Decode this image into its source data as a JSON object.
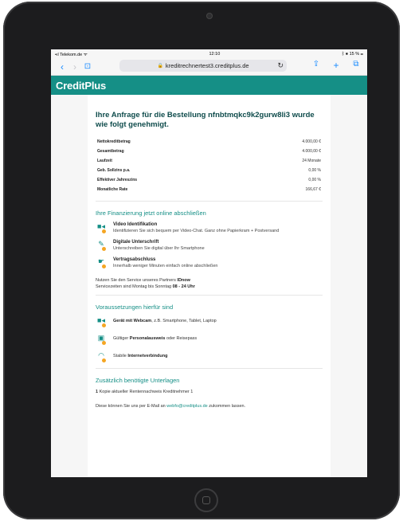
{
  "status": {
    "carrier": "Telekom.de",
    "time": "12:10",
    "battery": "15 %"
  },
  "browser": {
    "url": "kreditrechnertest3.creditplus.de",
    "icons": [
      "back-icon",
      "forward-icon",
      "bookmarks-icon",
      "reload-icon",
      "share-icon",
      "add-tab-icon",
      "tabs-icon"
    ]
  },
  "brand": {
    "logo_text": "CreditPlus",
    "color": "#158f86"
  },
  "main": {
    "headline": "Ihre Anfrage für die Bestellung nfnbtmqkc9k2gurw8li3 wurde wie folgt genehmigt.",
    "summary": [
      {
        "label": "Nettokreditbetrag",
        "value": "4.000,00 €"
      },
      {
        "label": "Gesamtbetrag",
        "value": "4.000,00 €"
      },
      {
        "label": "Laufzeit",
        "value": "24 Monate"
      },
      {
        "label": "Geb. Sollzins p.a.",
        "value": "0,00 %"
      },
      {
        "label": "Effektiver Jahreszins",
        "value": "0,00 %"
      },
      {
        "label": "Monatliche Rate",
        "value": "166,67 €"
      }
    ],
    "finance_title": "Ihre Finanzierung jetzt online abschließen",
    "steps": [
      {
        "icon": "video-camera-icon",
        "title": "Video Identifikation",
        "desc": "Identifizieren Sie sich bequem per Video-Chat. Ganz ohne Papierkram + Postversand"
      },
      {
        "icon": "signature-icon",
        "title": "Digitale Unterschrift",
        "desc": "Unterschreiben Sie digital über Ihr Smartphone"
      },
      {
        "icon": "handshake-icon",
        "title": "Vertragsabschluss",
        "desc": "Innerhalb weniger Minuten einfach online abschließen"
      }
    ],
    "partner_text_pre": "Nutzen Sie den Service unseres Partners ",
    "partner_name": "IDnow",
    "service_text_pre": "Servicezeiten sind Montag bis Sonntag ",
    "service_hours": "08 - 24 Uhr",
    "requirements_title": "Voraussetzungen hierfür sind",
    "requirements": [
      {
        "icon": "webcam-icon",
        "bold": "Gerät mit Webcam",
        "rest": ", z.B. Smartphone, Tablet, Laptop"
      },
      {
        "icon": "id-card-icon",
        "pre": "Gültiger ",
        "bold": "Personalausweis",
        "rest": " oder Reisepass"
      },
      {
        "icon": "wifi-icon",
        "pre": "Stabile ",
        "bold": "Internetverbindung",
        "rest": ""
      }
    ],
    "documents_title": "Zusätzlich benötigte Unterlagen",
    "doc_count": "1",
    "doc_text": " Kopie aktueller Rentennachweis Kreditnehmer 1",
    "footer_pre": "Diese können Sie uns per E-Mail an ",
    "footer_email": "webfo@creditplus.de",
    "footer_post": " zukommen lassen."
  }
}
